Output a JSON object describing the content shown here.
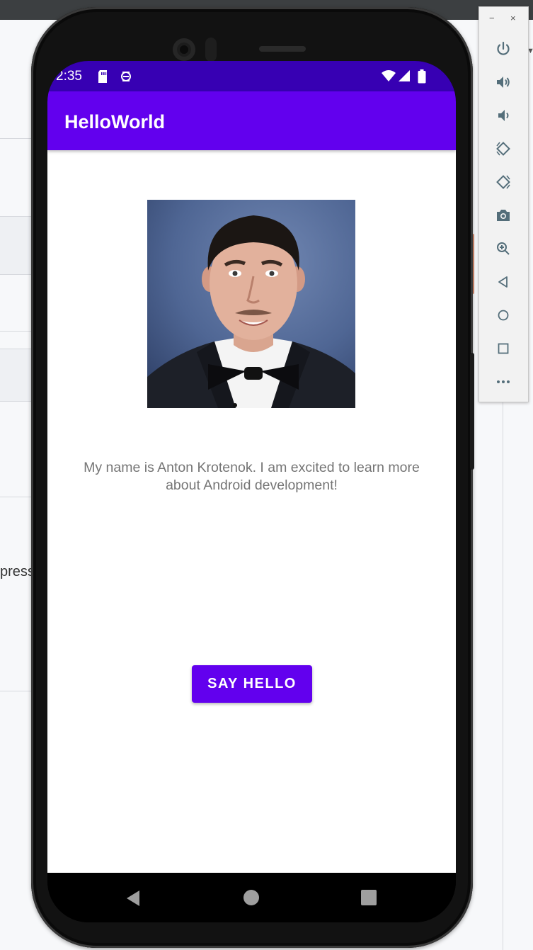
{
  "app": {
    "title": "HelloWorld",
    "time": "2:35"
  },
  "main": {
    "bio": "My name is Anton Krotenok. I am excited to learn more about Android development!",
    "button_label": "SAY HELLO"
  },
  "emulator": {
    "minimize": "−",
    "close": "×",
    "tools": [
      "power-icon",
      "volume-up-icon",
      "volume-down-icon",
      "rotate-left-icon",
      "rotate-right-icon",
      "camera-icon",
      "zoom-icon",
      "back-icon",
      "home-icon",
      "overview-icon",
      "more-icon"
    ]
  },
  "ide": {
    "fragment": "press"
  },
  "colors": {
    "status_bar": "#3700b3",
    "app_bar": "#6200ee",
    "button": "#6200ee",
    "body_text": "#757575"
  }
}
